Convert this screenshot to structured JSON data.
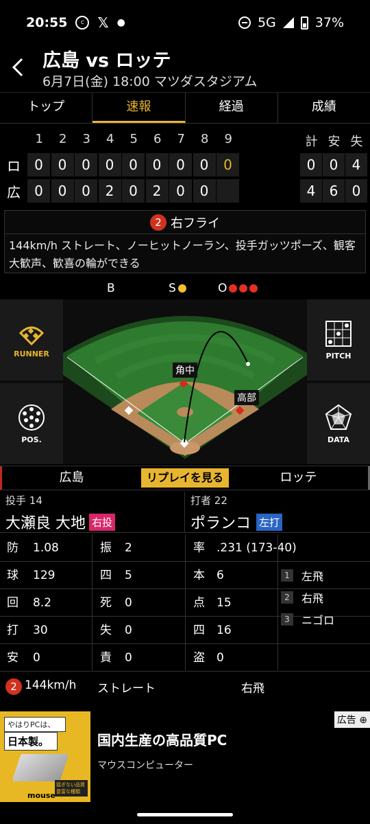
{
  "status_bar": {
    "time": "20:55",
    "network": "5G",
    "battery": "37%",
    "icons": [
      "carp-logo-icon",
      "x-logo-icon",
      "dot-icon",
      "dnd-icon",
      "signal-icon",
      "battery-icon"
    ]
  },
  "header": {
    "title": "広島 vs ロッテ",
    "subtitle": "6月7日(金) 18:00 マツダスタジアム"
  },
  "tabs": [
    {
      "label": "トップ",
      "active": false
    },
    {
      "label": "速報",
      "active": true
    },
    {
      "label": "経過",
      "active": false
    },
    {
      "label": "成績",
      "active": false
    }
  ],
  "scoreboard": {
    "innings": [
      "1",
      "2",
      "3",
      "4",
      "5",
      "6",
      "7",
      "8",
      "9"
    ],
    "totals_headers": [
      "計",
      "安",
      "失"
    ],
    "rows": [
      {
        "team": "ロ",
        "scores": [
          "0",
          "0",
          "0",
          "0",
          "0",
          "0",
          "0",
          "0",
          "0"
        ],
        "totals": [
          "0",
          "0",
          "4"
        ]
      },
      {
        "team": "広",
        "scores": [
          "0",
          "0",
          "0",
          "2",
          "0",
          "2",
          "0",
          "0",
          ""
        ],
        "totals": [
          "4",
          "6",
          "0"
        ]
      }
    ]
  },
  "play": {
    "number": "2",
    "result": "右フライ",
    "description": "144km/h ストレート、ノーヒットノーラン、投手ガッツポーズ、観客大歓声、歓喜の輪ができる"
  },
  "count": {
    "b_label": "B",
    "s_label": "S",
    "o_label": "O",
    "balls": 0,
    "strikes": 1,
    "outs": 3
  },
  "field": {
    "left_buttons": [
      "RUNNER",
      "POS."
    ],
    "right_buttons": [
      "PITCH",
      "DATA"
    ],
    "fielder_labels": [
      "角中",
      "高部"
    ]
  },
  "teambar": {
    "home": "広島",
    "replay": "リプレイを見る",
    "away": "ロッテ"
  },
  "pitcher": {
    "role": "投手",
    "number": "14",
    "name": "大瀬良 大地",
    "hand": "右投"
  },
  "batter": {
    "role": "打者",
    "number": "22",
    "name": "ポランコ",
    "hand": "左打"
  },
  "pitcher_stats": [
    {
      "k": "防",
      "v": "1.08",
      "k2": "振",
      "v2": "2"
    },
    {
      "k": "球",
      "v": "129",
      "k2": "四",
      "v2": "5"
    },
    {
      "k": "回",
      "v": "8.2",
      "k2": "死",
      "v2": "0"
    },
    {
      "k": "打",
      "v": "30",
      "k2": "失",
      "v2": "0"
    },
    {
      "k": "安",
      "v": "0",
      "k2": "責",
      "v2": "0"
    }
  ],
  "batter_stats": [
    {
      "k": "率",
      "v": ".231 (173-40)"
    },
    {
      "k": "本",
      "v": "6"
    },
    {
      "k": "点",
      "v": "15"
    },
    {
      "k": "四",
      "v": "16"
    },
    {
      "k": "盗",
      "v": "0"
    }
  ],
  "at_bat_history": [
    {
      "n": "1",
      "result": "左飛"
    },
    {
      "n": "2",
      "result": "右飛"
    },
    {
      "n": "3",
      "result": "ニゴロ"
    }
  ],
  "pitch_row": {
    "number": "2",
    "speed": "144km/h",
    "type": "ストレート",
    "result": "右飛"
  },
  "ad": {
    "tag": "広告",
    "img_line1": "やはりPCは、",
    "img_line2": "日本製。",
    "img_spec": "揺ぎない品質 豊富な種類",
    "img_brand": "mouse",
    "title": "国内生産の高品質PC",
    "sponsor": "マウスコンピューター"
  }
}
